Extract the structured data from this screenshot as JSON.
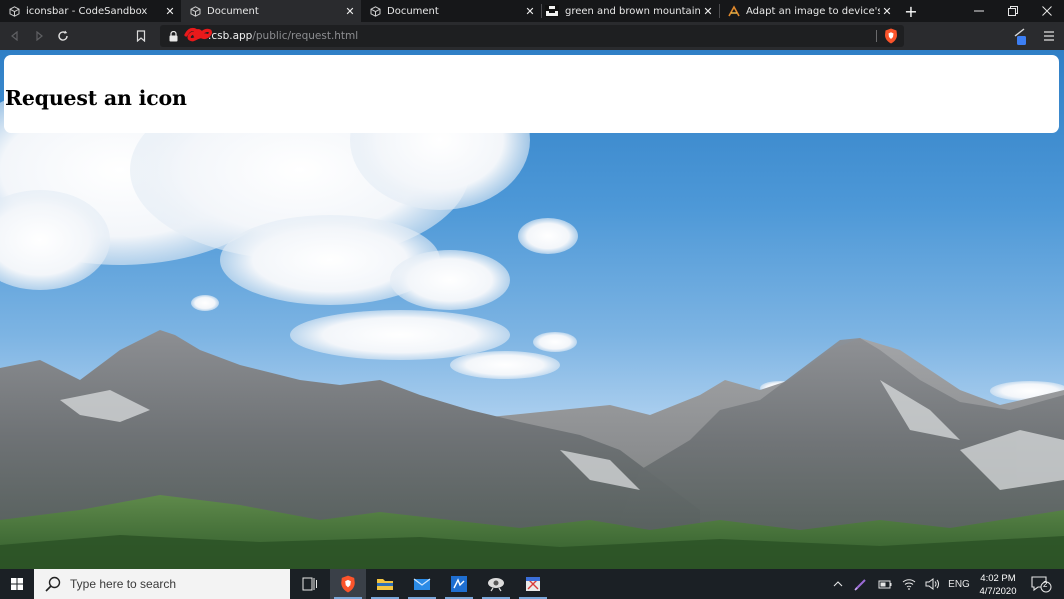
{
  "tabs": [
    {
      "title": "iconsbar - CodeSandbox",
      "icon": "codesandbox-icon",
      "active": false
    },
    {
      "title": "Document",
      "icon": "codesandbox-icon",
      "active": true
    },
    {
      "title": "Document",
      "icon": "codesandbox-icon",
      "active": false
    },
    {
      "title": "green and brown mountains unde",
      "icon": "unsplash-icon",
      "active": false
    },
    {
      "title": "Adapt an image to device's resolut",
      "icon": "mdn-icon",
      "active": false
    }
  ],
  "address": {
    "host": ".csb.app",
    "path": "/public/request.html"
  },
  "page": {
    "heading": "Request an icon"
  },
  "taskbar": {
    "search_placeholder": "Type here to search",
    "language": "ENG",
    "time": "4:02 PM",
    "date": "4/7/2020",
    "notification_count": "2"
  },
  "colors": {
    "accent": "#7aa7d9",
    "brave_orange": "#fb542b",
    "redaction": "#e8191b"
  }
}
